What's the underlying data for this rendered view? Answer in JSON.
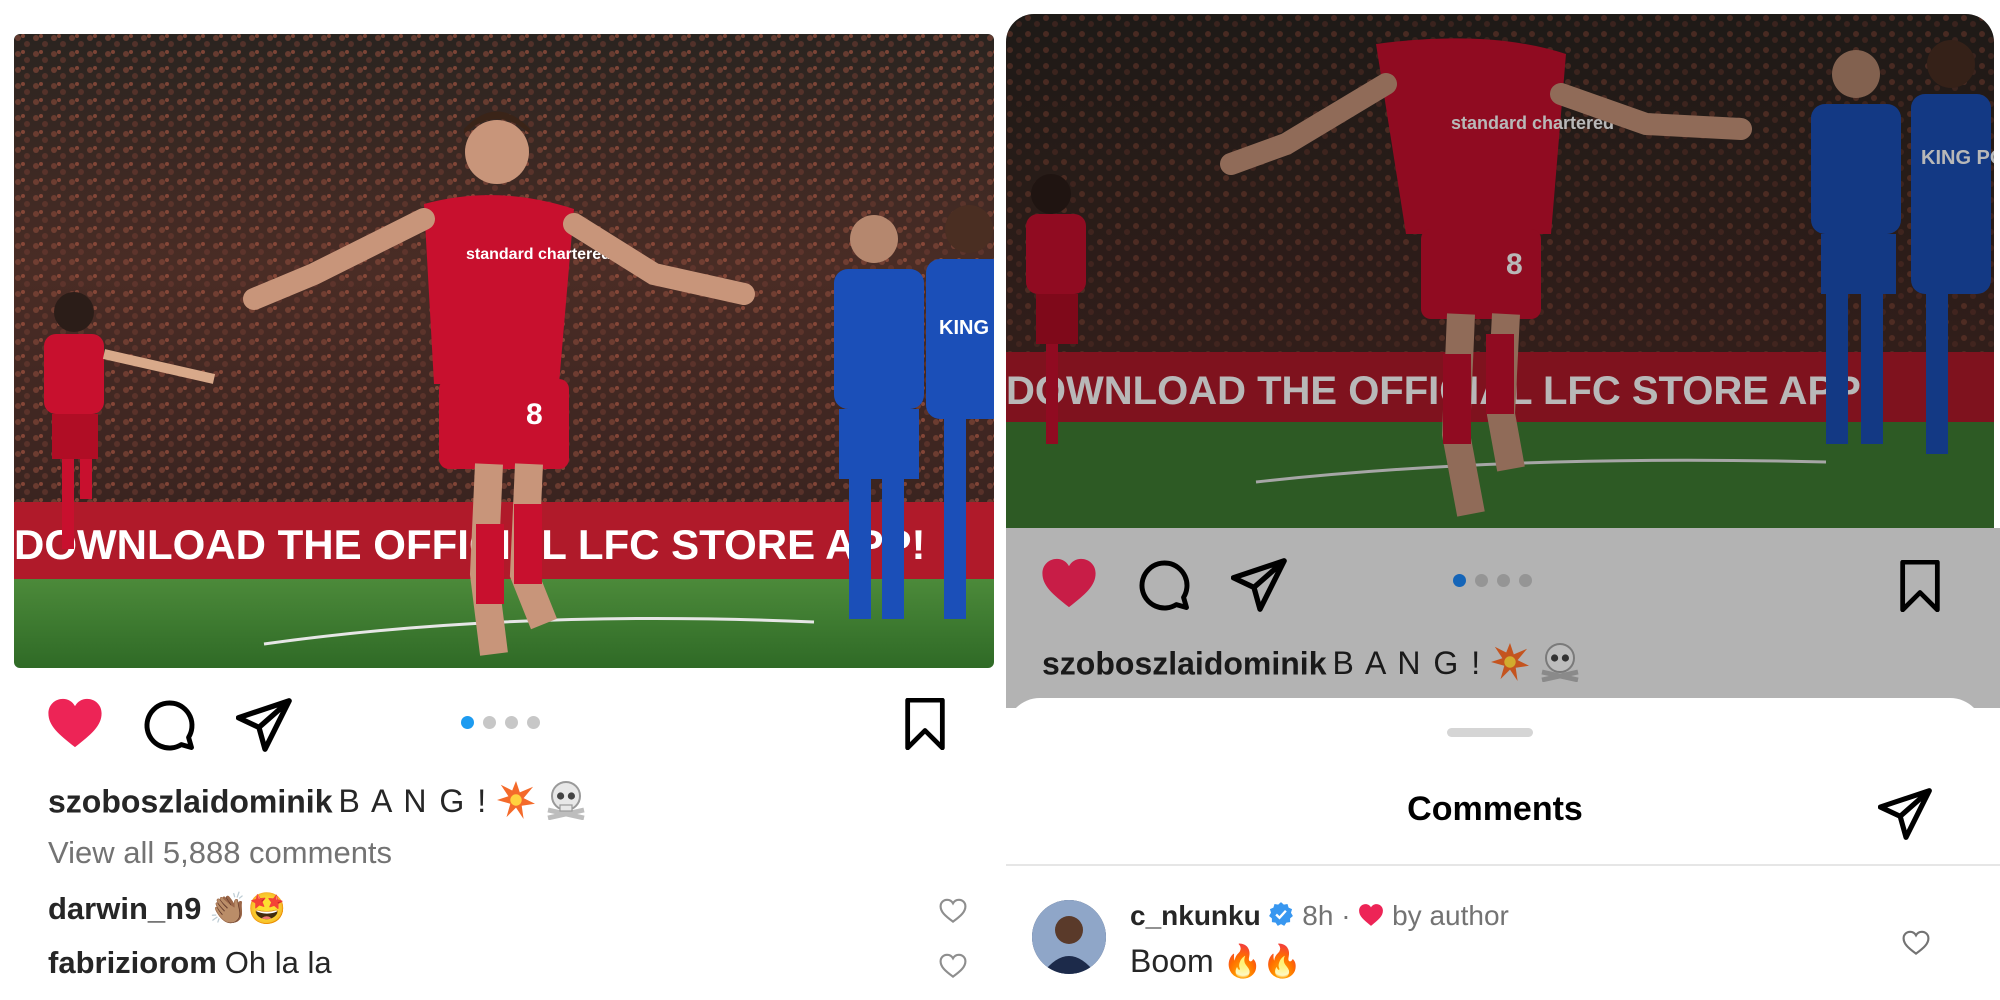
{
  "left_post": {
    "caption_user": "szoboszlaidominik",
    "caption_text": "B A N G !",
    "caption_emojis": [
      "collision",
      "skull-and-crossbones"
    ],
    "view_all_comments": "View all 5,888 comments",
    "comments": [
      {
        "user": "darwin_n9",
        "text": "👏🏽🤩"
      },
      {
        "user": "fabriziorom",
        "text": "Oh la la"
      }
    ],
    "carousel": {
      "count": 4,
      "active_index": 0
    },
    "liked": true
  },
  "right_post": {
    "caption_user": "szoboszlaidominik",
    "caption_text": "B A N G !",
    "carousel": {
      "count": 4,
      "active_index": 0
    },
    "liked": true
  },
  "photo": {
    "banner_text": "DOWNLOAD THE OFFICIAL LFC STORE APP!",
    "sponsor": "standard chartered",
    "opponent_sponsor": "KING POWER",
    "player_number": "8"
  },
  "comments_sheet": {
    "title": "Comments",
    "comment": {
      "user": "c_nkunku",
      "verified": true,
      "time": "8h",
      "separator": "·",
      "liked_by_author_label": "by author",
      "text": "Boom 🔥🔥"
    }
  },
  "colors": {
    "like_red": "#ed2456",
    "accent_blue": "#1d9bf0",
    "verified_blue": "#3897f0",
    "liverpool_red": "#c8102e",
    "leicester_blue": "#1b4fb8",
    "pitch_green": "#3f7d32"
  }
}
